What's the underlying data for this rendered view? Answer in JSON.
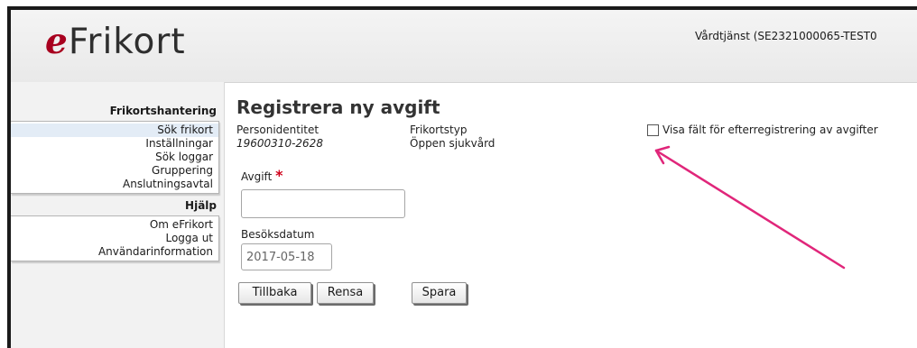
{
  "header": {
    "logo_prefix": "e",
    "logo_text": "Frikort",
    "care_service": "Vårdtjänst (SE2321000065-TEST0"
  },
  "sidebar": {
    "section1_heading": "Frikortshantering",
    "section1_items": [
      "Sök frikort",
      "Inställningar",
      "Sök loggar",
      "Gruppering",
      "Anslutningsavtal"
    ],
    "section2_heading": "Hjälp",
    "section2_items": [
      "Om eFrikort",
      "Logga ut",
      "Användarinformation"
    ]
  },
  "main": {
    "title": "Registrera ny avgift",
    "personidentitet_label": "Personidentitet",
    "personidentitet_value": "19600310-2628",
    "frikortstyp_label": "Frikortstyp",
    "frikortstyp_value": "Öppen sjukvård",
    "avgift_label": "Avgift",
    "avgift_required": "*",
    "avgift_value": "",
    "besoksdatum_label": "Besöksdatum",
    "besoksdatum_value": "2017-05-18",
    "checkbox_label": "Visa fält för efterregistrering av avgifter",
    "checkbox_checked": false,
    "buttons": {
      "back": "Tillbaka",
      "clear": "Rensa",
      "save": "Spara"
    }
  },
  "colors": {
    "brand": "#a8001f",
    "arrow": "#e0267a",
    "required": "#d0021b"
  }
}
